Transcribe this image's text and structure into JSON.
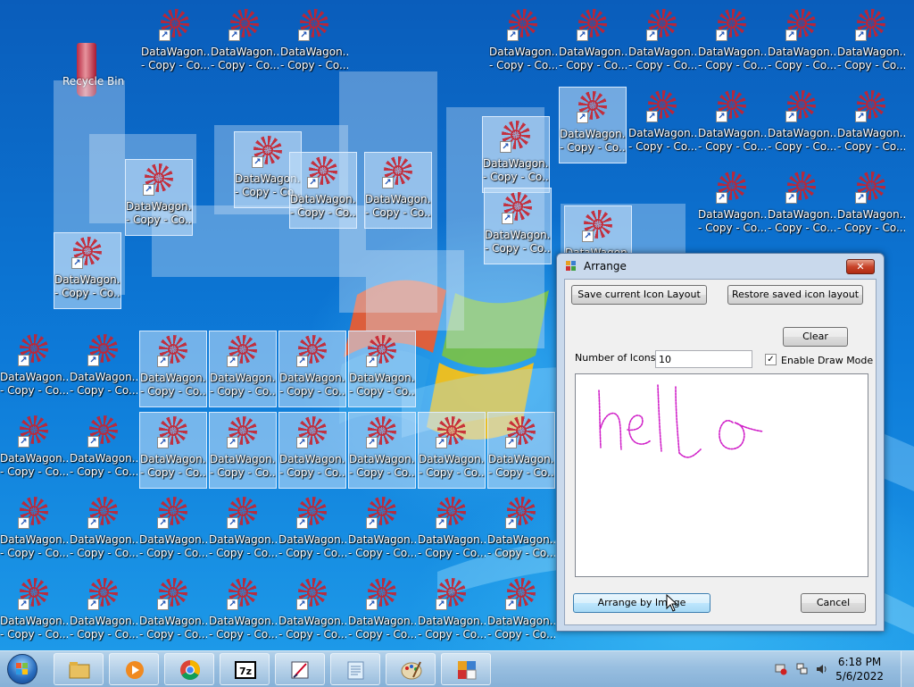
{
  "desktop": {
    "recycle_bin_label": "Recycle Bin",
    "icon_line1": "DataWagon...",
    "icon_line2": "- Copy - Co...",
    "icon_count_visible": 60
  },
  "arrange_window": {
    "title": "Arrange",
    "save_layout_label": "Save current Icon Layout",
    "restore_layout_label": "Restore saved icon layout",
    "clear_label": "Clear",
    "number_of_icons_label": "Number of Icons:",
    "number_of_icons_value": "10",
    "enable_draw_mode_label": "Enable Draw Mode",
    "enable_draw_mode_checked": true,
    "arrange_by_image_label": "Arrange by Image",
    "cancel_label": "Cancel",
    "drawing_text": "hello",
    "drawing_color": "#d020c8"
  },
  "taskbar": {
    "items": [
      "Windows Explorer",
      "Windows Media Player",
      "Google Chrome",
      "7-Zip",
      "Editor",
      "Notepad",
      "Paint",
      "Arrange"
    ],
    "time": "6:18 PM",
    "date": "5/6/2022"
  }
}
